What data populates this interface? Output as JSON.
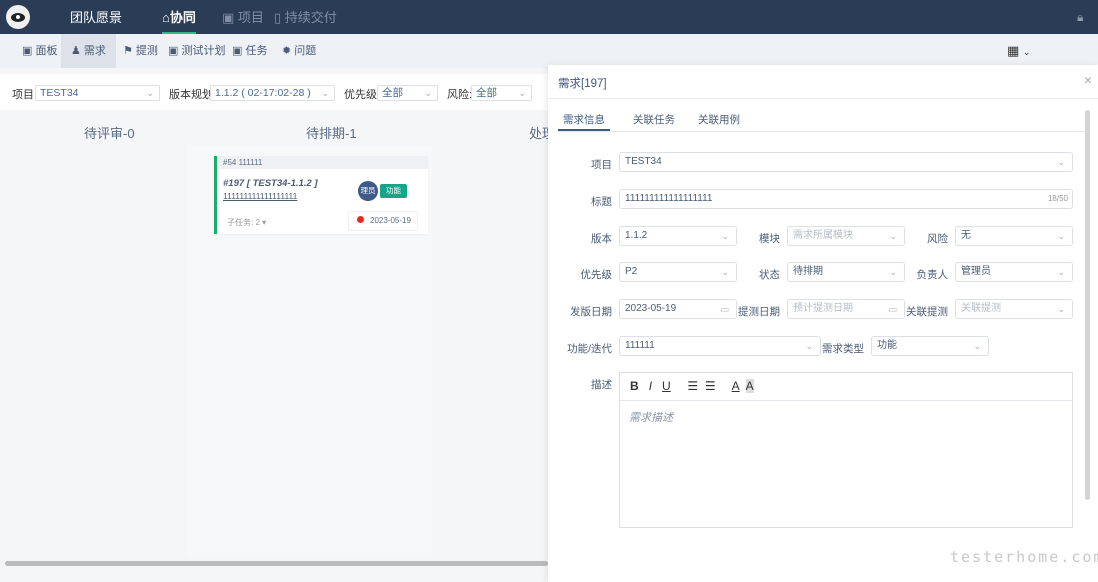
{
  "header": {
    "nav": [
      "团队愿景",
      "协同",
      "项目",
      "持续交付"
    ]
  },
  "subnav": [
    "面板",
    "需求",
    "提测",
    "测试计划",
    "任务",
    "问题"
  ],
  "filters": {
    "project_label": "项目:",
    "project": "TEST34",
    "version_label": "版本规划:",
    "version": "1.1.2 ( 02-17:02-28 )",
    "priority_label": "优先级:",
    "priority": "全部",
    "risk_label": "风险:",
    "risk": "全部"
  },
  "board": {
    "columns": [
      "待评审-0",
      "待排期-1",
      "处理"
    ],
    "card": {
      "parent": "#54 111111",
      "title": "#197 [ TEST34-1.1.2 ]",
      "name": "111111111111111111",
      "avatar": "理员",
      "type": "功能",
      "subtasks": "子任务: 2",
      "date": "2023-05-19"
    }
  },
  "drawer": {
    "title": "需求[197]",
    "tabs": [
      "需求信息",
      "关联任务",
      "关联用例"
    ],
    "form": {
      "project_label": "项目",
      "project": "TEST34",
      "title_label": "标题",
      "title": "111111111111111111",
      "title_count": "18/50",
      "version_label": "版本",
      "version": "1.1.2",
      "module_label": "模块",
      "module_ph": "需求所属模块",
      "risk_label": "风险",
      "risk": "无",
      "priority_label": "优先级",
      "priority": "P2",
      "status_label": "状态",
      "status": "待排期",
      "owner_label": "负责人",
      "owner": "管理员",
      "release_label": "发版日期",
      "release": "2023-05-19",
      "test_label": "提测日期",
      "test_ph": "预计提测日期",
      "link_label": "关联提测",
      "link_ph": "关联提测",
      "feature_label": "功能/迭代",
      "feature": "111111",
      "type_label": "需求类型",
      "type": "功能",
      "desc_label": "描述",
      "desc_ph": "需求描述"
    }
  },
  "watermark": "testerhome.com"
}
